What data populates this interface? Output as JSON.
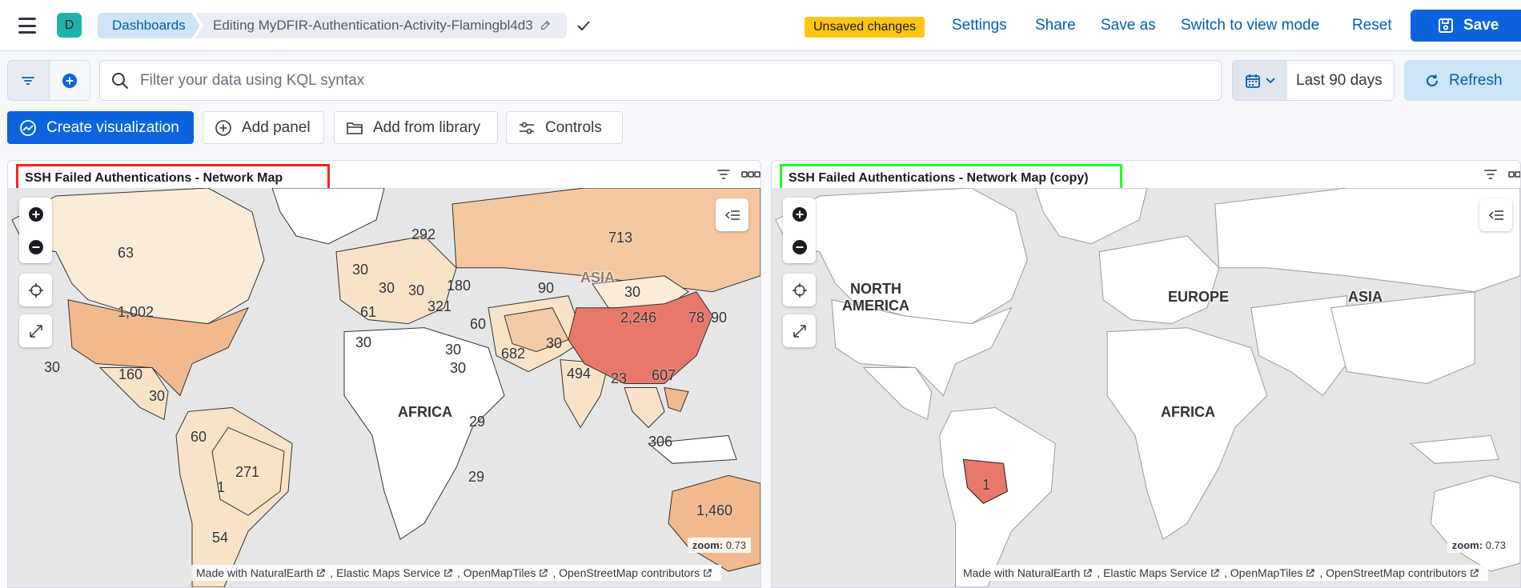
{
  "header": {
    "avatar_letter": "D",
    "breadcrumb_root": "Dashboards",
    "breadcrumb_current": "Editing MyDFIR-Authentication-Activity-Flamingbl4d3",
    "unsaved_badge": "Unsaved changes",
    "links": {
      "settings": "Settings",
      "share": "Share",
      "save_as": "Save as",
      "switch_mode": "Switch to view mode",
      "reset": "Reset"
    },
    "save_label": "Save"
  },
  "query": {
    "placeholder": "Filter your data using KQL syntax",
    "date_range": "Last 90 days",
    "refresh_label": "Refresh"
  },
  "toolbar": {
    "create_visualization": "Create visualization",
    "add_panel": "Add panel",
    "add_from_library": "Add from library",
    "controls": "Controls"
  },
  "panels": [
    {
      "title": "SSH Failed Authentications - Network Map",
      "zoom_label": "zoom:",
      "zoom_value": "0.73",
      "continent_labels": [
        "AFRICA",
        "ASIA"
      ],
      "country_values": [
        "713",
        "63",
        "292",
        "1,002",
        "90",
        "30",
        "180",
        "30",
        "61",
        "30",
        "321",
        "30",
        "2,246",
        "60",
        "682",
        "78",
        "90",
        "30",
        "30",
        "160",
        "494",
        "23",
        "607",
        "30",
        "29",
        "306",
        "60",
        "271",
        "1",
        "29",
        "1,460",
        "54",
        "30",
        "30",
        "30"
      ]
    },
    {
      "title": "SSH Failed Authentications - Network Map (copy)",
      "zoom_label": "zoom:",
      "zoom_value": "0.73",
      "continent_labels": [
        "NORTH AMERICA",
        "EUROPE",
        "ASIA",
        "AFRICA"
      ],
      "country_values": [
        "1"
      ]
    }
  ],
  "attribution": {
    "naturalearth": "Made with NaturalEarth",
    "ems": "Elastic Maps Service",
    "omt": "OpenMapTiles",
    "osm": "OpenStreetMap contributors"
  },
  "colors": {
    "accent": "#0b64dd",
    "choropleth_low": "#f8e3c8",
    "choropleth_mid": "#f1b98d",
    "choropleth_high": "#e8786a",
    "highlight_red": "#ff1f1f",
    "highlight_green": "#1fff1f",
    "unsaved_badge": "#fec514"
  }
}
